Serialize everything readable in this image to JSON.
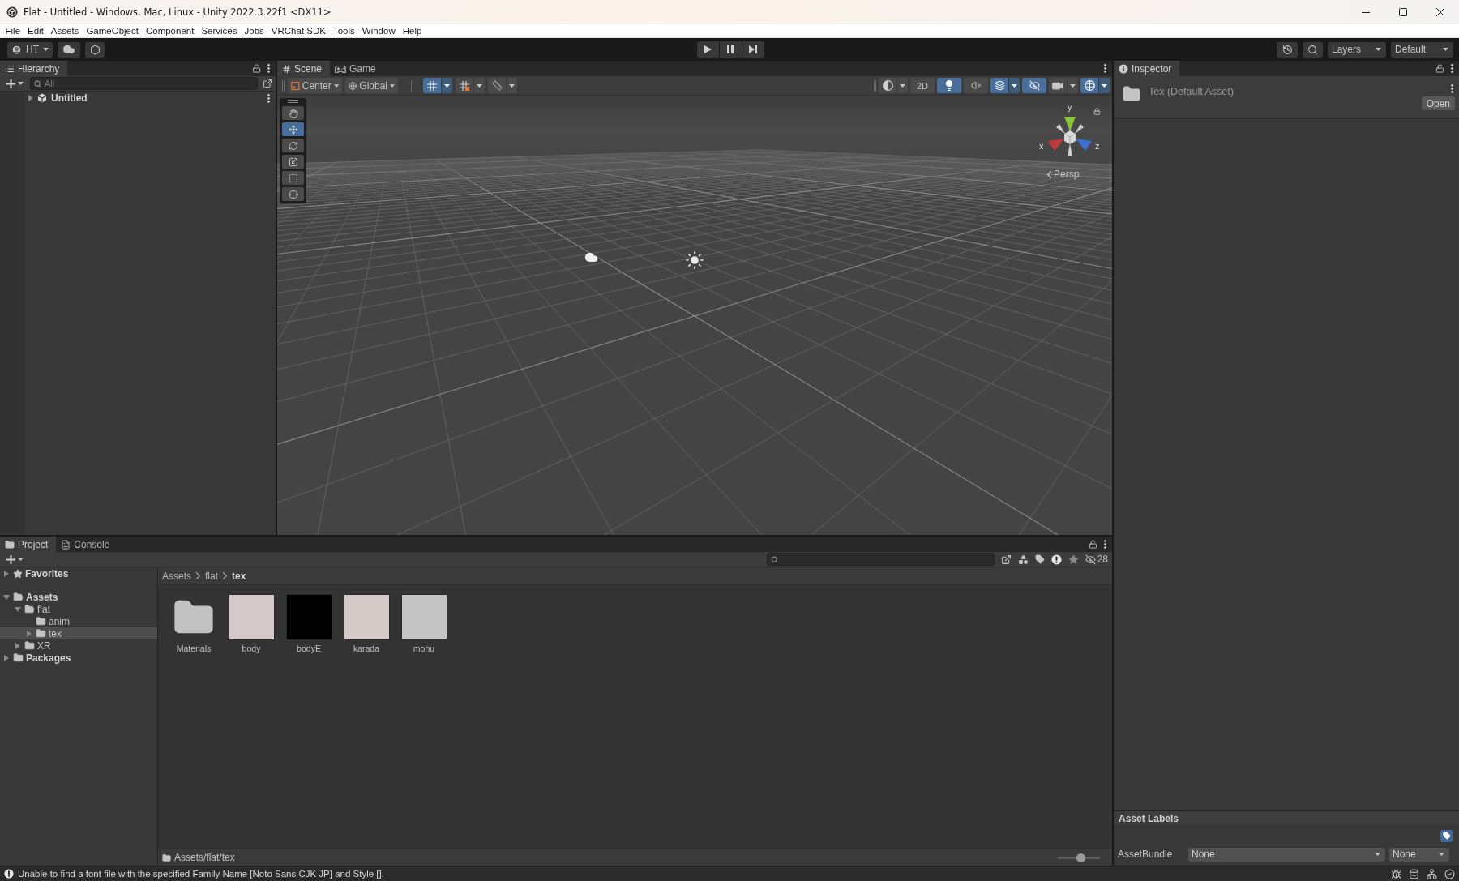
{
  "window": {
    "title": "Flat - Untitled - Windows, Mac, Linux - Unity 2022.3.22f1 <DX11>"
  },
  "menu": [
    "File",
    "Edit",
    "Assets",
    "GameObject",
    "Component",
    "Services",
    "Jobs",
    "VRChat SDK",
    "Tools",
    "Window",
    "Help"
  ],
  "toolbar": {
    "account": "HT",
    "play_controls": [
      {
        "kind": "play"
      },
      {
        "kind": "pause"
      },
      {
        "kind": "step"
      }
    ],
    "layers": "Layers",
    "layout": "Default"
  },
  "hierarchy": {
    "title": "Hierarchy",
    "search": {
      "placeholder": "All"
    },
    "items": [
      {
        "label": "Untitled",
        "expanded": false
      }
    ]
  },
  "scene": {
    "tabs": [
      {
        "label": "Scene",
        "selected": true
      },
      {
        "label": "Game",
        "selected": false
      }
    ],
    "pivot": "Center",
    "space": "Global",
    "snapping": [
      {
        "kind": "grid",
        "on": true
      },
      {
        "kind": "snap",
        "on": false
      },
      {
        "kind": "increment",
        "on": false
      }
    ],
    "view_options": [
      {
        "kind": "shading",
        "on": false
      },
      {
        "kind": "dimension",
        "label": "2D",
        "on": false
      },
      {
        "kind": "lighting",
        "on": true
      },
      {
        "kind": "audio",
        "on": false
      },
      {
        "kind": "effects",
        "on": true
      },
      {
        "kind": "visibility",
        "on": true
      },
      {
        "kind": "camera",
        "on": false
      },
      {
        "kind": "gizmos",
        "on": true
      }
    ],
    "tools": [
      {
        "kind": "hand",
        "selected": false
      },
      {
        "kind": "move",
        "selected": true
      },
      {
        "kind": "rotate",
        "selected": false
      },
      {
        "kind": "scale",
        "selected": false
      },
      {
        "kind": "rect",
        "selected": false
      },
      {
        "kind": "transform",
        "selected": false
      }
    ],
    "gizmo": {
      "y_label": "y",
      "x_label": "x",
      "z_label": "z",
      "projection": "Persp"
    }
  },
  "inspector": {
    "title": "Inspector",
    "asset": "Tex (Default Asset)",
    "open": "Open",
    "labels_title": "Asset Labels",
    "bundle_label": "AssetBundle",
    "bundle": "None",
    "variant": "None"
  },
  "project": {
    "tabs": [
      {
        "label": "Project",
        "selected": true
      },
      {
        "label": "Console",
        "selected": false
      }
    ],
    "favorites": {
      "label": "Favorites",
      "expanded": false
    },
    "tree": [
      {
        "label": "Assets",
        "expanded": true,
        "selected": false,
        "children": [
          {
            "label": "flat",
            "expanded": true,
            "selected": false,
            "children": [
              {
                "label": "anim",
                "selected": false
              },
              {
                "label": "tex",
                "expanded": false,
                "selected": true
              }
            ]
          },
          {
            "label": "XR",
            "expanded": false,
            "selected": false
          }
        ]
      },
      {
        "label": "Packages",
        "expanded": false,
        "selected": false
      }
    ],
    "breadcrumb": [
      "Assets",
      "flat",
      "tex"
    ],
    "hidden_count": "28",
    "items": [
      {
        "label": "Materials",
        "kind": "folder"
      },
      {
        "label": "body",
        "kind": "texture",
        "color": "#d3c9c8"
      },
      {
        "label": "bodyE",
        "kind": "texture",
        "color": "#000000"
      },
      {
        "label": "karada",
        "kind": "texture",
        "color": "#d6cac9"
      },
      {
        "label": "mohu",
        "kind": "texture",
        "color": "#c3c3c3"
      }
    ],
    "path": "Assets/flat/tex",
    "zoom": {
      "level": 0.55
    }
  },
  "status": {
    "message": "Unable to find a font file with the specified Family Name [Noto Sans CJK JP] and Style []."
  }
}
